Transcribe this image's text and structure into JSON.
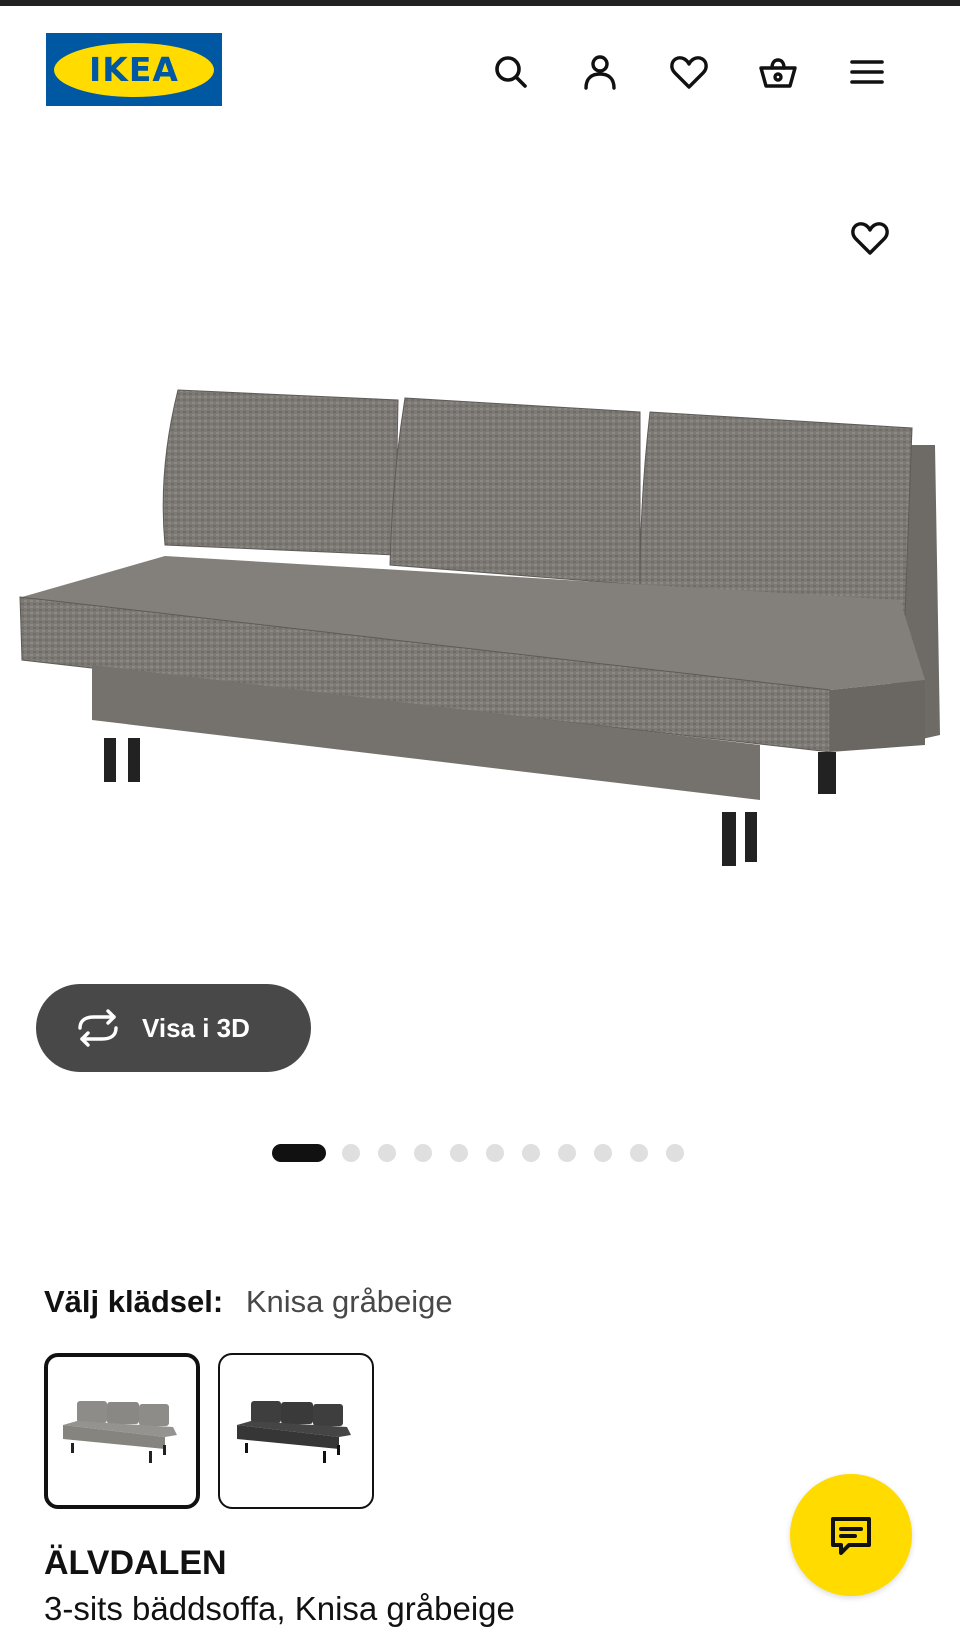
{
  "header": {
    "logo_text": "IKEA",
    "icons": [
      "search-icon",
      "account-icon",
      "heart-icon",
      "basket-icon",
      "menu-icon"
    ]
  },
  "product_image": {
    "favorite_icon": "heart-icon"
  },
  "view_3d": {
    "label": "Visa i 3D",
    "icon": "rotate-3d-icon"
  },
  "carousel": {
    "total_images": 12,
    "active_index": 0
  },
  "fabric": {
    "label": "Välj klädsel:",
    "selected_value": "Knisa gråbeige",
    "swatch_colors": [
      "#8e8c88",
      "#3e3e3e"
    ]
  },
  "product": {
    "name": "ÄLVDALEN",
    "description": "3-sits bäddsoffa, Knisa gråbeige"
  },
  "chat": {
    "icon": "chat-icon",
    "color": "#ffdb00"
  },
  "colors": {
    "brand_blue": "#0058a3",
    "brand_yellow": "#ffdb00",
    "button_dark": "#484848"
  }
}
